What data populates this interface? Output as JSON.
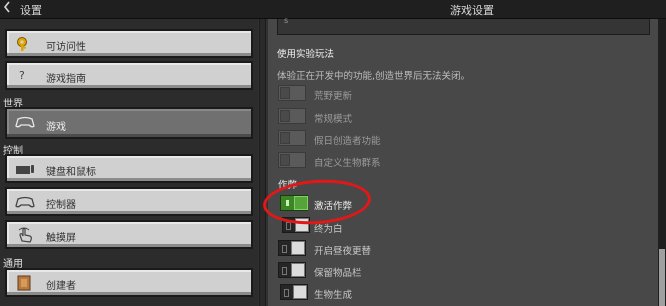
{
  "titlebar": {
    "back_icon": "chevron-left-icon",
    "left_title": "设置",
    "right_title": "游戏设置"
  },
  "sidebar": {
    "items_top": [
      {
        "label": "可访问性",
        "icon": "key-icon"
      },
      {
        "label": "游戏指南",
        "icon": "question-icon"
      }
    ],
    "section_world": "世界",
    "world_items": [
      {
        "label": "游戏",
        "icon": "gamepad-icon",
        "selected": true
      }
    ],
    "section_controls": "控制",
    "control_items": [
      {
        "label": "键盘和鼠标",
        "icon": "keyboard-icon"
      },
      {
        "label": "控制器",
        "icon": "gamepad-icon"
      },
      {
        "label": "触摸屏",
        "icon": "touch-hand-icon"
      }
    ],
    "section_general": "通用",
    "general_items": [
      {
        "label": "创建者",
        "icon": "creator-icon"
      }
    ]
  },
  "experimental": {
    "heading": "使用实验玩法",
    "description": "体验正在开发中的功能,创造世界后无法关闭。",
    "toggles": [
      {
        "label": "荒野更新",
        "state": "disabled"
      },
      {
        "label": "常规模式",
        "state": "disabled"
      },
      {
        "label": "假日创造者功能",
        "state": "disabled"
      },
      {
        "label": "自定义生物群系",
        "state": "disabled"
      }
    ]
  },
  "cheats": {
    "heading": "作弊",
    "toggles": [
      {
        "label": "激活作弊",
        "state": "on"
      },
      {
        "label": "终为白",
        "state": "off"
      },
      {
        "label": "开启昼夜更替",
        "state": "off"
      },
      {
        "label": "保留物品栏",
        "state": "off"
      },
      {
        "label": "生物生成",
        "state": "off"
      }
    ]
  },
  "colors": {
    "accent_green": "#3c8527",
    "annotation_red": "#e21818"
  }
}
